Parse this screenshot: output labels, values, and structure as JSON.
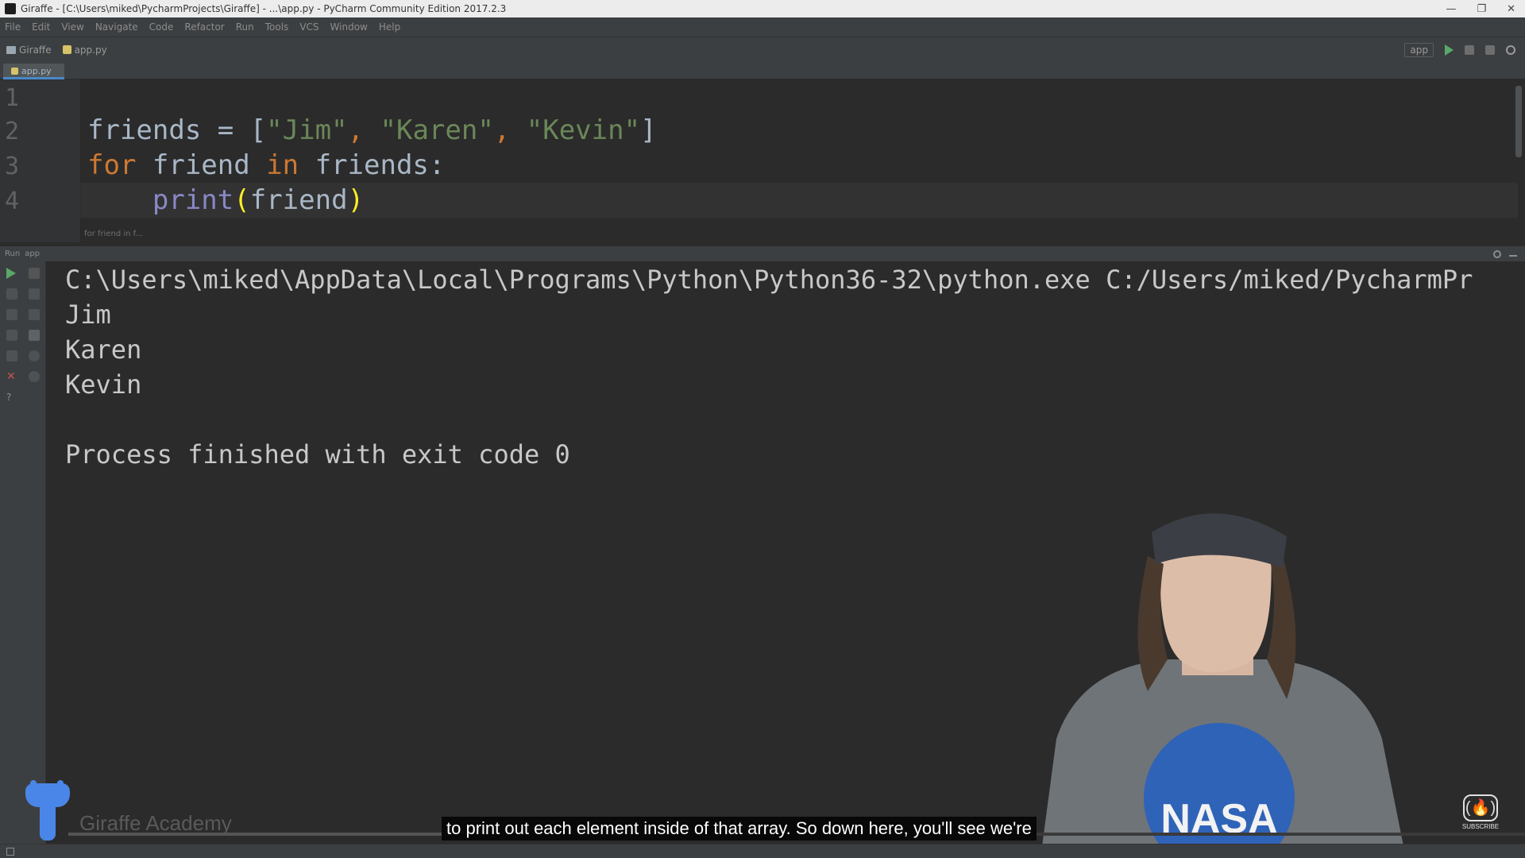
{
  "window": {
    "title": "Giraffe - [C:\\Users\\miked\\PycharmProjects\\Giraffe] - ...\\app.py - PyCharm Community Edition 2017.2.3"
  },
  "menu": [
    "File",
    "Edit",
    "View",
    "Navigate",
    "Code",
    "Refactor",
    "Run",
    "Tools",
    "VCS",
    "Window",
    "Help"
  ],
  "nav": {
    "project": "Giraffe",
    "file": "app.py",
    "run_config": "app"
  },
  "tab": {
    "label": "app.py"
  },
  "editor": {
    "line_numbers": [
      "1",
      "2",
      "3",
      "4"
    ],
    "hint": "for friend in f..."
  },
  "run_panel": {
    "label": "Run",
    "config": "app"
  },
  "console": {
    "lines": [
      "C:\\Users\\miked\\AppData\\Local\\Programs\\Python\\Python36-32\\python.exe C:/Users/miked/PycharmPr",
      "Jim",
      "Karen",
      "Kevin",
      "",
      "Process finished with exit code 0"
    ]
  },
  "watermark": {
    "text": "Giraffe Academy"
  },
  "caption": {
    "text": "to print out each element inside of that array. So down here, you'll see we're"
  },
  "subscribe": {
    "label": "SUBSCRIBE"
  },
  "shirt": {
    "text": "NASA"
  },
  "colors": {
    "keyword": "#cc7832",
    "string": "#6a8759",
    "builtin": "#8888c6",
    "paren": "#ffef28",
    "logo": "#4a86e8"
  }
}
